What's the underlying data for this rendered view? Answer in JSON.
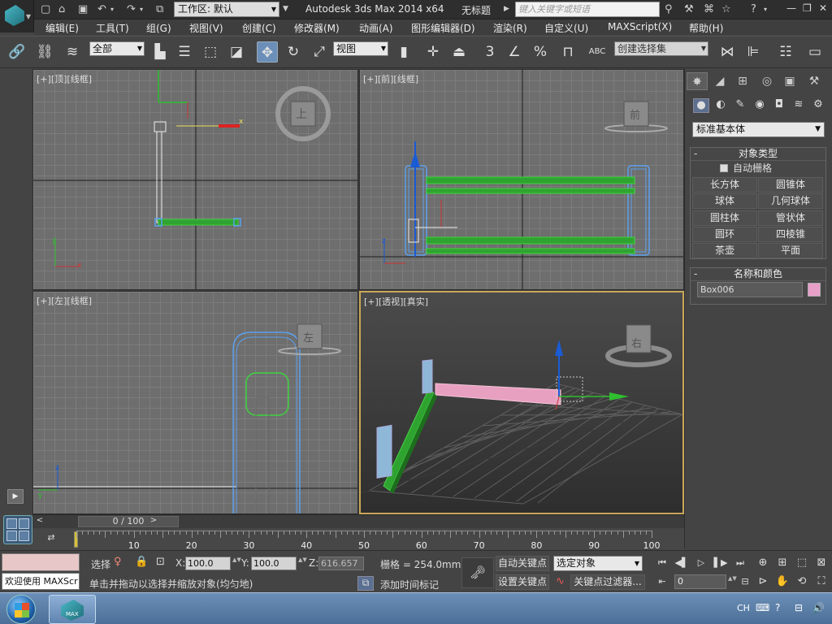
{
  "title_bar": {
    "workspace_label": "工作区: 默认",
    "app_title": "Autodesk 3ds Max  2014 x64",
    "doc_title": "无标题",
    "search_placeholder": "键入关键字或短语"
  },
  "menu": [
    {
      "label": "编辑(E)"
    },
    {
      "label": "工具(T)"
    },
    {
      "label": "组(G)"
    },
    {
      "label": "视图(V)"
    },
    {
      "label": "创建(C)"
    },
    {
      "label": "修改器(M)"
    },
    {
      "label": "动画(A)"
    },
    {
      "label": "图形编辑器(D)"
    },
    {
      "label": "渲染(R)"
    },
    {
      "label": "自定义(U)"
    },
    {
      "label": "MAXScript(X)"
    },
    {
      "label": "帮助(H)"
    }
  ],
  "toolbar": {
    "filter_value": "全部",
    "coord_system": "视图",
    "snap_3": "3",
    "percent": "%",
    "named_selection_placeholder": "创建选择集",
    "abc": "ABC"
  },
  "viewports": {
    "top": {
      "plus": "[+]",
      "name": "[顶]",
      "mode": "[线框]",
      "cube": "上"
    },
    "front": {
      "plus": "[+]",
      "name": "[前]",
      "mode": "[线框]",
      "cube": "前"
    },
    "left": {
      "plus": "[+]",
      "name": "[左]",
      "mode": "[线框]",
      "cube": "左"
    },
    "persp": {
      "plus": "[+]",
      "name": "[透视]",
      "mode": "[真实]",
      "cube": "右"
    },
    "axis_x": "x",
    "axis_y": "y",
    "axis_z": "z"
  },
  "command_panel": {
    "category": "标准基本体",
    "object_type": {
      "title": "对象类型",
      "autogrid": "自动栅格",
      "buttons": [
        "长方体",
        "圆锥体",
        "球体",
        "几何球体",
        "圆柱体",
        "管状体",
        "圆环",
        "四棱锥",
        "茶壶",
        "平面"
      ]
    },
    "name_color": {
      "title": "名称和颜色",
      "name_value": "Box006",
      "swatch_color": "#e8a0c8"
    }
  },
  "timeline": {
    "frame_readout": "0 / 100",
    "ticks": [
      "10",
      "20",
      "30",
      "40",
      "50",
      "60",
      "70",
      "80",
      "90",
      "100"
    ]
  },
  "status": {
    "welcome": "欢迎使用 MAXScr",
    "selected_short": "选择",
    "x_label": "X:",
    "x_value": "100.0",
    "y_label": "Y:",
    "y_value": "100.0",
    "z_label": "Z:",
    "z_value": "616.657",
    "grid": "栅格 = 254.0mm",
    "prompt": "单击并拖动以选择并缩放对象(均匀地)",
    "add_time_tag": "添加时间标记",
    "auto_key": "自动关键点",
    "set_key": "设置关键点",
    "key_mode": "选定对象",
    "key_filters": "关键点过滤器...",
    "current_frame": "0"
  },
  "taskbar": {
    "max_label": "MAX",
    "lang": "CH"
  }
}
